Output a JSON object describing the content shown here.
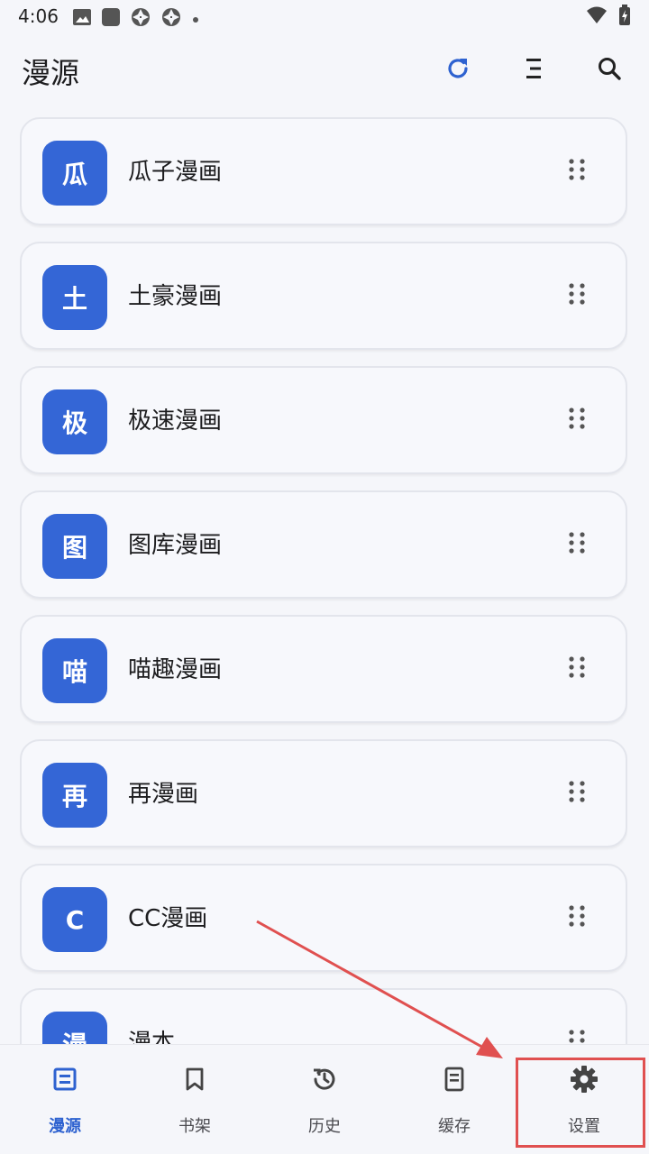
{
  "status_bar": {
    "time": "4:06"
  },
  "app_bar": {
    "title": "漫源",
    "refresh_icon": "refresh-icon",
    "sort_icon": "sort-icon",
    "search_icon": "search-icon"
  },
  "sources": [
    {
      "avatar": "瓜",
      "name": "瓜子漫画"
    },
    {
      "avatar": "土",
      "name": "土豪漫画"
    },
    {
      "avatar": "极",
      "name": "极速漫画"
    },
    {
      "avatar": "图",
      "name": "图库漫画"
    },
    {
      "avatar": "喵",
      "name": "喵趣漫画"
    },
    {
      "avatar": "再",
      "name": "再漫画"
    },
    {
      "avatar": "C",
      "name": "CC漫画"
    },
    {
      "avatar": "漫",
      "name": "漫本"
    }
  ],
  "bottom_nav": [
    {
      "label": "漫源",
      "icon": "source-icon",
      "active": true
    },
    {
      "label": "书架",
      "icon": "bookmark-icon",
      "active": false
    },
    {
      "label": "历史",
      "icon": "history-icon",
      "active": false
    },
    {
      "label": "缓存",
      "icon": "cache-icon",
      "active": false
    },
    {
      "label": "设置",
      "icon": "gear-icon",
      "active": false
    }
  ],
  "colors": {
    "accent": "#2e62d0",
    "avatar_bg": "#3466d6",
    "annotation": "#e05050"
  }
}
